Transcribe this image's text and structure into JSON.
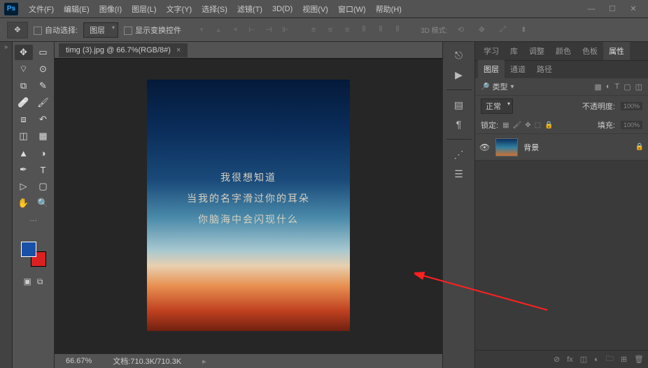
{
  "menu": [
    "文件(F)",
    "编辑(E)",
    "图像(I)",
    "图层(L)",
    "文字(Y)",
    "选择(S)",
    "滤镜(T)",
    "3D(D)",
    "视图(V)",
    "窗口(W)",
    "帮助(H)"
  ],
  "options": {
    "auto_select": "自动选择:",
    "layer_dd": "图层",
    "show_transform": "显示变换控件",
    "mode_3d": "3D 模式:"
  },
  "doc_tab": "timg (3).jpg @ 66.7%(RGB/8#)",
  "canvas_text": {
    "l1": "我很想知道",
    "l2": "当我的名字滑过你的耳朵",
    "l3": "你脑海中会闪现什么"
  },
  "status": {
    "zoom": "66.67%",
    "doc_label": "文档:",
    "doc_size": "710.3K/710.3K"
  },
  "top_tabs": [
    "学习",
    "库",
    "调整",
    "颜色",
    "色板",
    "属性"
  ],
  "layer_tabs": [
    "图层",
    "通道",
    "路径"
  ],
  "layers": {
    "kind": "类型",
    "blend": "正常",
    "opacity_label": "不透明度:",
    "opacity": "100%",
    "lock_label": "锁定:",
    "fill_label": "填充:",
    "fill": "100%",
    "bg_layer": "背景"
  }
}
